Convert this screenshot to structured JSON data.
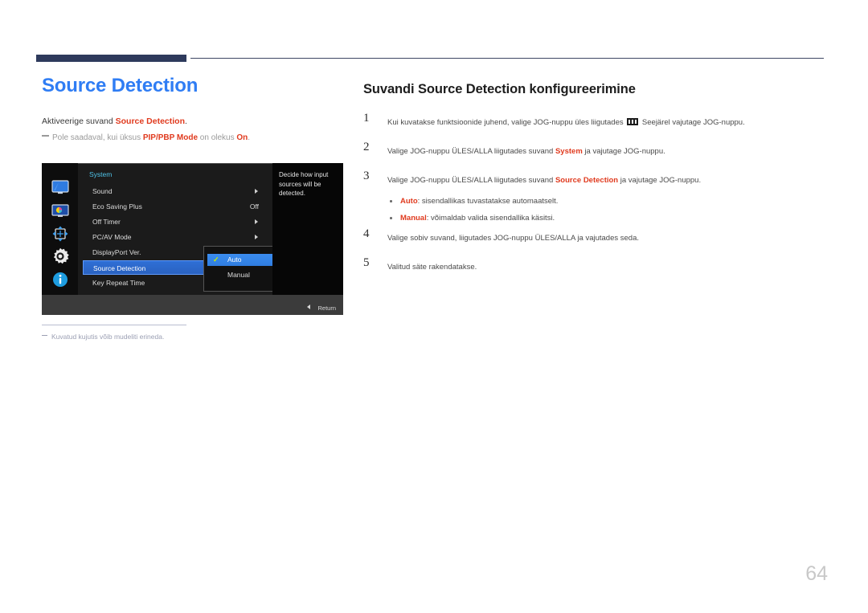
{
  "page": {
    "number": "64",
    "accent_blue": "#2f7df4",
    "accent_red": "#e03a1e",
    "rule_navy": "#2e3a5c"
  },
  "left": {
    "title": "Source Detection",
    "intro_prefix": "Aktiveerige suvand ",
    "intro_keyword": "Source Detection",
    "intro_suffix": ".",
    "note_prefix": "Pole saadaval, kui üksus ",
    "note_keyword1": "PIP/PBP Mode",
    "note_middle": " on olekus ",
    "note_keyword2": "On",
    "note_suffix": ".",
    "footnote": "Kuvatud kujutis võib mudeliti erineda."
  },
  "osd": {
    "header": "System",
    "description": "Decide how input sources will be detected.",
    "return_label": "Return",
    "sidebar_icons": [
      "display-monitor-icon",
      "picture-color-icon",
      "pip-arrows-icon",
      "system-gear-icon",
      "information-icon"
    ],
    "rows": [
      {
        "label": "Sound",
        "value": "",
        "arrow": true,
        "selected": false
      },
      {
        "label": "Eco Saving Plus",
        "value": "Off",
        "arrow": false,
        "selected": false
      },
      {
        "label": "Off Timer",
        "value": "",
        "arrow": true,
        "selected": false
      },
      {
        "label": "PC/AV Mode",
        "value": "",
        "arrow": true,
        "selected": false
      },
      {
        "label": "DisplayPort Ver.",
        "value": "",
        "arrow": false,
        "selected": false
      },
      {
        "label": "Source Detection",
        "value": "",
        "arrow": false,
        "selected": true
      },
      {
        "label": "Key Repeat Time",
        "value": "",
        "arrow": false,
        "selected": false
      }
    ],
    "submenu": [
      {
        "label": "Auto",
        "checked": true
      },
      {
        "label": "Manual",
        "checked": false
      }
    ]
  },
  "right": {
    "section_title": "Suvandi Source Detection konfigureerimine",
    "steps": [
      {
        "num": "1",
        "text_before": "Kui kuvatakse funktsioonide juhend, valige JOG-nuppu üles liigutades ",
        "has_icon": true,
        "text_after": " Seejärel vajutage JOG-nuppu."
      },
      {
        "num": "2",
        "text_before": "Valige JOG-nuppu ÜLES/ALLA liigutades suvand ",
        "keyword": "System",
        "text_after": " ja vajutage JOG-nuppu."
      },
      {
        "num": "3",
        "text_before": "Valige JOG-nuppu ÜLES/ALLA liigutades suvand ",
        "keyword": "Source Detection",
        "text_after": " ja vajutage JOG-nuppu."
      },
      {
        "num": "4",
        "text_before": "Valige sobiv suvand, liigutades JOG-nuppu ÜLES/ALLA ja vajutades seda.",
        "keyword": "",
        "text_after": ""
      },
      {
        "num": "5",
        "text_before": "Valitud säte rakendatakse.",
        "keyword": "",
        "text_after": ""
      }
    ],
    "bullets": [
      {
        "keyword": "Auto",
        "text": ": sisendallikas tuvastatakse automaatselt."
      },
      {
        "keyword": "Manual",
        "text": ": võimaldab valida sisendallika käsitsi."
      }
    ]
  }
}
